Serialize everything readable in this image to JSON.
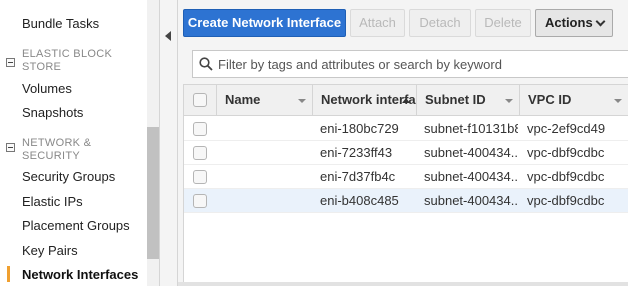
{
  "sidebar": {
    "items_top": [
      {
        "label": "Bundle Tasks"
      }
    ],
    "sections": [
      {
        "title": "ELASTIC BLOCK STORE",
        "items": [
          {
            "label": "Volumes"
          },
          {
            "label": "Snapshots"
          }
        ]
      },
      {
        "title": "NETWORK & SECURITY",
        "items": [
          {
            "label": "Security Groups"
          },
          {
            "label": "Elastic IPs"
          },
          {
            "label": "Placement Groups"
          },
          {
            "label": "Key Pairs"
          },
          {
            "label": "Network Interfaces",
            "active": true
          }
        ]
      }
    ]
  },
  "toolbar": {
    "create_label": "Create Network Interface",
    "attach_label": "Attach",
    "detach_label": "Detach",
    "delete_label": "Delete",
    "actions_label": "Actions"
  },
  "search": {
    "placeholder": "Filter by tags and attributes or search by keyword",
    "value": ""
  },
  "table": {
    "columns": [
      "Name",
      "Network interfa",
      "Subnet ID",
      "VPC ID"
    ],
    "sorted_column": "Network interfa",
    "rows": [
      {
        "name": "",
        "eni": "eni-180bc729",
        "subnet": "subnet-f10131b8",
        "vpc": "vpc-2ef9cd49",
        "selected": false
      },
      {
        "name": "",
        "eni": "eni-7233ff43",
        "subnet": "subnet-400434...",
        "vpc": "vpc-dbf9cdbc",
        "selected": false
      },
      {
        "name": "",
        "eni": "eni-7d37fb4c",
        "subnet": "subnet-400434...",
        "vpc": "vpc-dbf9cdbc",
        "selected": false
      },
      {
        "name": "",
        "eni": "eni-b408c485",
        "subnet": "subnet-400434...",
        "vpc": "vpc-dbf9cdbc",
        "selected": true
      }
    ]
  },
  "colors": {
    "primary": "#2d73d2",
    "active_marker": "#f0a030",
    "selected_row": "#eaf2fb"
  }
}
